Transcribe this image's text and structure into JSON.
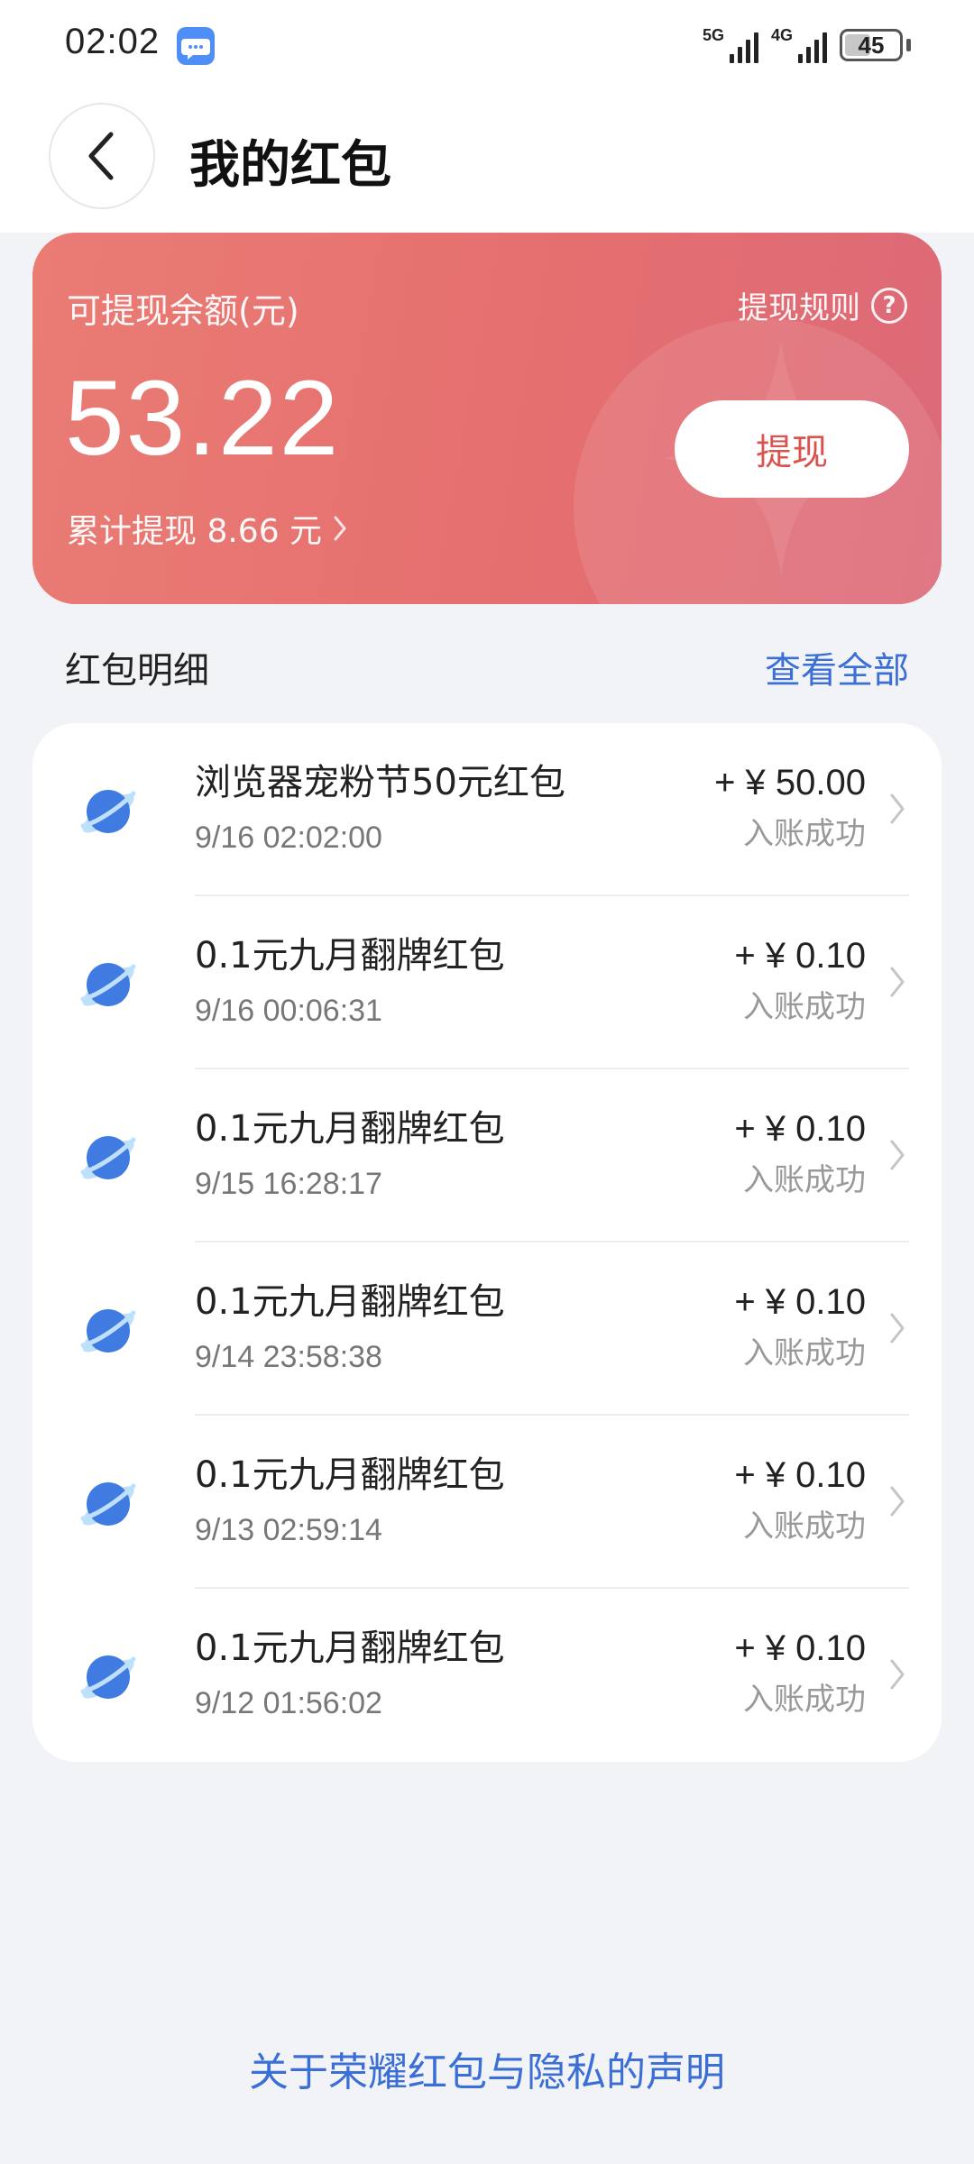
{
  "status_bar": {
    "time": "02:02",
    "network1": "5G",
    "network2": "4G",
    "battery": "45"
  },
  "header": {
    "title": "我的红包"
  },
  "balance_card": {
    "label": "可提现余额(元)",
    "rules_label": "提现规则",
    "amount": "53.22",
    "total_withdraw": "累计提现 8.66 元",
    "withdraw_button": "提现"
  },
  "details": {
    "section_title": "红包明细",
    "view_all": "查看全部",
    "items": [
      {
        "title": "浏览器宠粉节50元红包",
        "time": "9/16 02:02:00",
        "amount": "+ ¥ 50.00",
        "status": "入账成功"
      },
      {
        "title": "0.1元九月翻牌红包",
        "time": "9/16 00:06:31",
        "amount": "+ ¥ 0.10",
        "status": "入账成功"
      },
      {
        "title": "0.1元九月翻牌红包",
        "time": "9/15 16:28:17",
        "amount": "+ ¥ 0.10",
        "status": "入账成功"
      },
      {
        "title": "0.1元九月翻牌红包",
        "time": "9/14 23:58:38",
        "amount": "+ ¥ 0.10",
        "status": "入账成功"
      },
      {
        "title": "0.1元九月翻牌红包",
        "time": "9/13 02:59:14",
        "amount": "+ ¥ 0.10",
        "status": "入账成功"
      },
      {
        "title": "0.1元九月翻牌红包",
        "time": "9/12 01:56:02",
        "amount": "+ ¥ 0.10",
        "status": "入账成功"
      }
    ]
  },
  "footer": {
    "privacy_link": "关于荣耀红包与隐私的声明"
  },
  "colors": {
    "accent_blue": "#3b6fd6",
    "card_red": "#e56f6f",
    "withdraw_text": "#d9534f"
  },
  "icons": {
    "back": "chevron-left-icon",
    "help": "help-circle-icon",
    "row": "planet-icon",
    "row_arrow": "chevron-right-icon"
  }
}
